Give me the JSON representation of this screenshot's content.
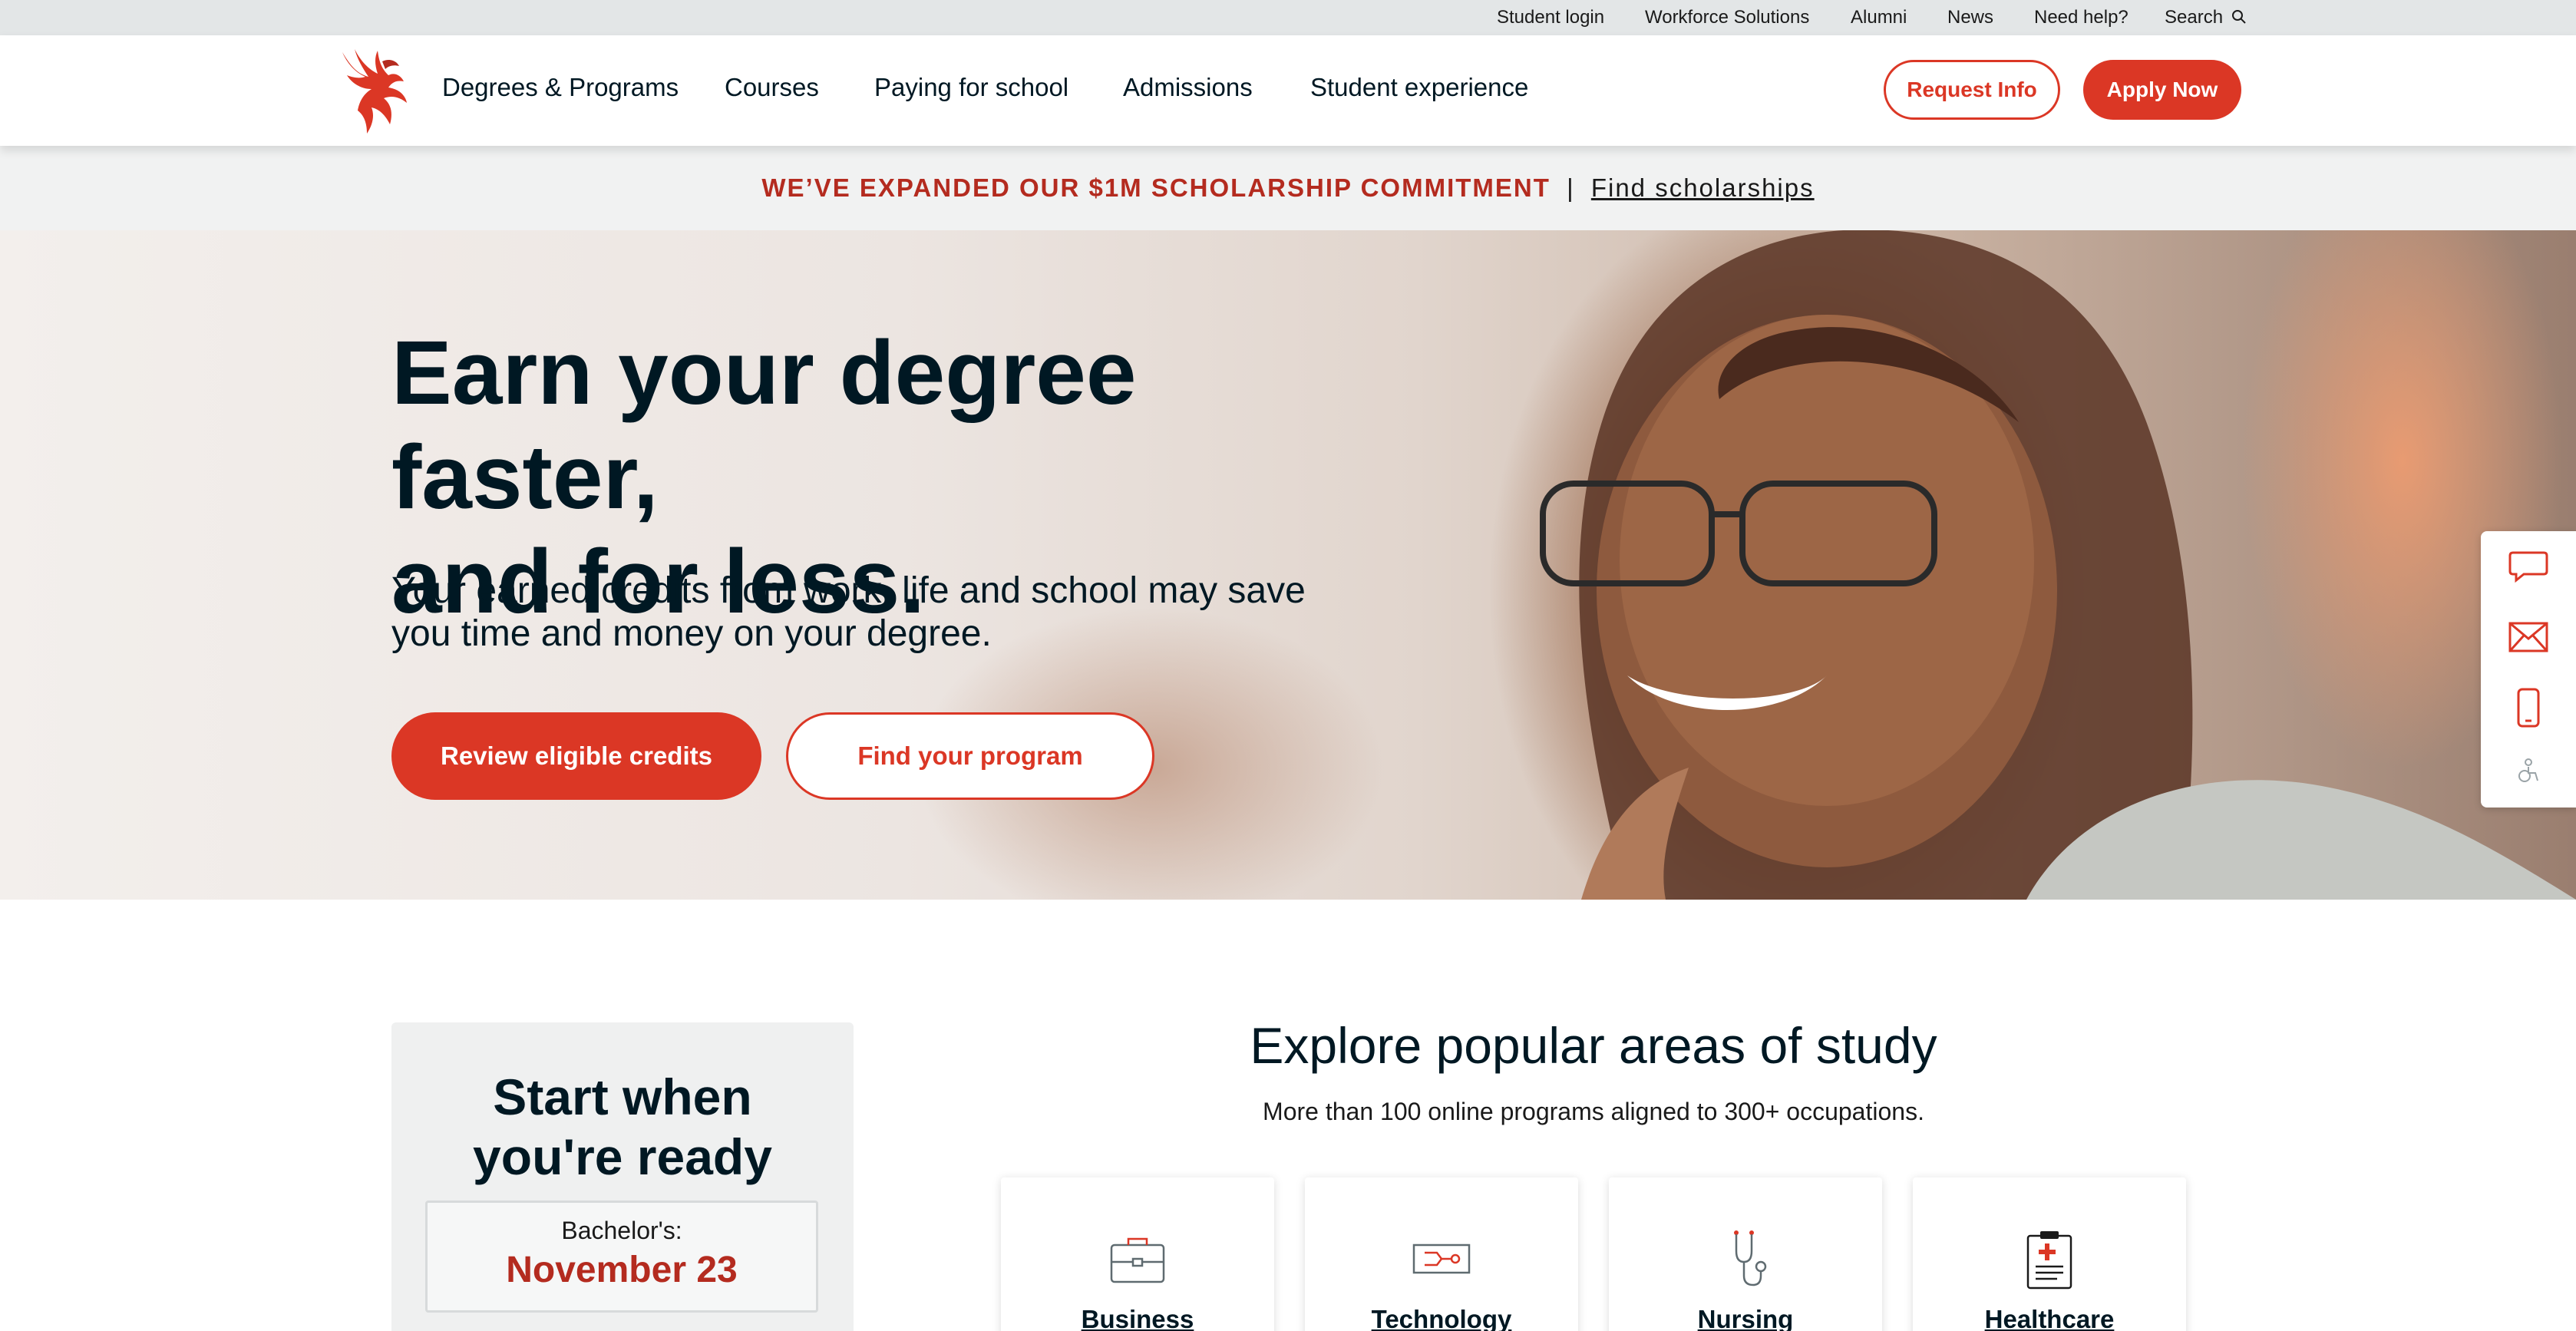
{
  "utility": {
    "links": [
      "Student login",
      "Workforce Solutions",
      "Alumni",
      "News",
      "Need help?"
    ],
    "search_label": "Search"
  },
  "nav": {
    "items": [
      "Degrees & Programs",
      "Courses",
      "Paying for school",
      "Admissions",
      "Student experience"
    ],
    "request_info": "Request Info",
    "apply_now": "Apply Now"
  },
  "banner": {
    "headline": "WE’VE EXPANDED OUR $1M SCHOLARSHIP COMMITMENT",
    "separator": "|",
    "link": "Find scholarships"
  },
  "hero": {
    "title_line1": "Earn your degree faster,",
    "title_line2": "and for less.",
    "subtitle_line1": "Your earned credits from work, life and school may save",
    "subtitle_line2": "you time and money on your degree.",
    "primary_cta": "Review eligible credits",
    "secondary_cta": "Find your program"
  },
  "side_tools": [
    "chat-icon",
    "email-icon",
    "phone-icon",
    "accessibility-icon"
  ],
  "start": {
    "title_line1": "Start when",
    "title_line2": "you're ready",
    "degree_label": "Bachelor's:",
    "start_date": "November 23"
  },
  "explore": {
    "title": "Explore popular areas of study",
    "subtitle": "More than 100 online programs aligned to 300+ occupations.",
    "areas": [
      {
        "label": "Business",
        "icon": "briefcase-icon"
      },
      {
        "label": "Technology",
        "icon": "circuit-tag-icon"
      },
      {
        "label": "Nursing",
        "icon": "stethoscope-icon"
      },
      {
        "label": "Healthcare",
        "icon": "medical-clipboard-icon"
      }
    ]
  },
  "colors": {
    "brand_red": "#db3725",
    "dark_red": "#b42b1f",
    "navy_text": "#001823",
    "utility_bg": "#e3e6e7",
    "banner_bg": "#f1f2f2"
  }
}
